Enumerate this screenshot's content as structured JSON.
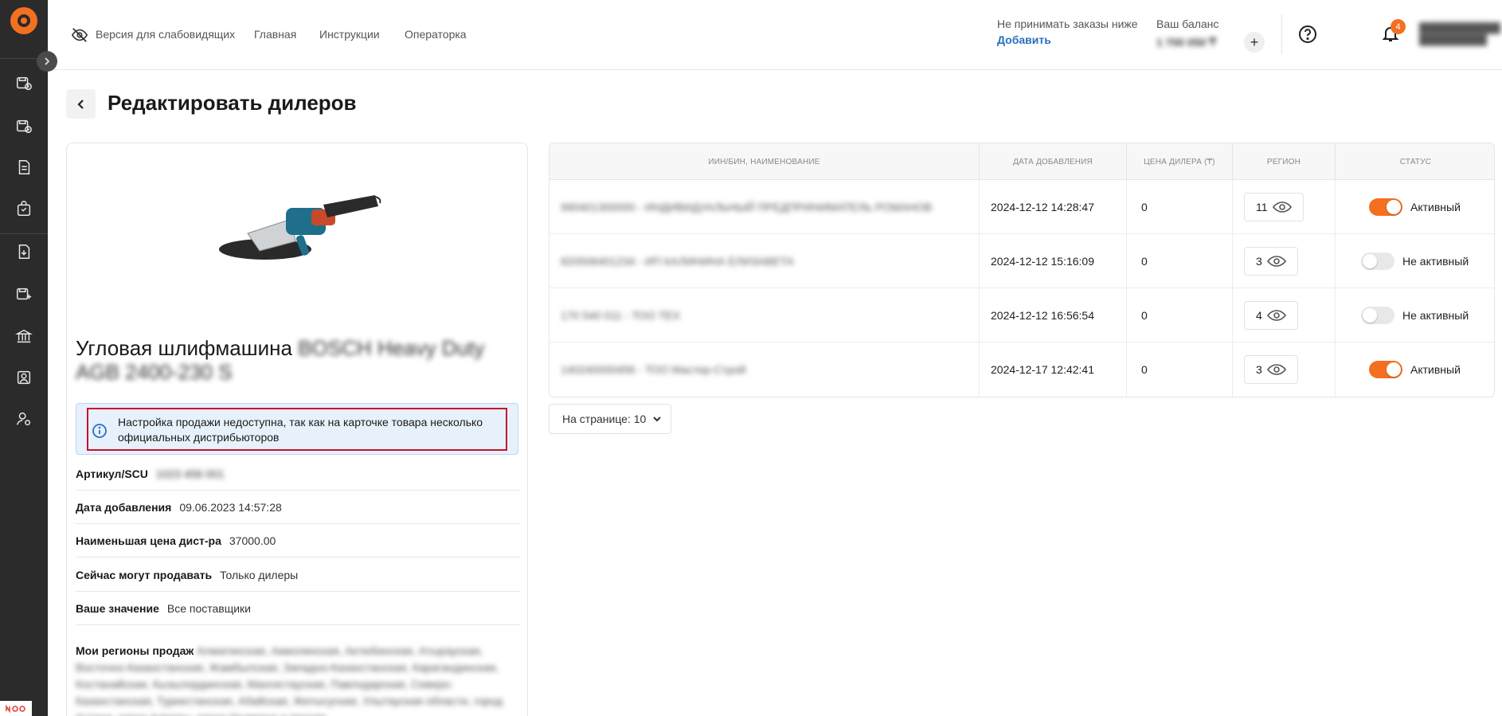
{
  "header": {
    "accessibility_label": "Версия для слабовидящих",
    "nav": [
      "Главная",
      "Инструкции",
      "Операторка"
    ],
    "no_orders_label": "Не принимать заказы ниже",
    "add_link": "Добавить",
    "balance_label": "Ваш баланс",
    "balance_value": "1 700 050 ₸",
    "notifications_count": "4",
    "user_name": "████████████ ██████████"
  },
  "page": {
    "title": "Редактировать дилеров"
  },
  "product": {
    "title": "Угловая шлифмашина",
    "title_blurred": "BOSCH Heavy Duty AGB 2400-230 S",
    "info_message": "Настройка продажи недоступна, так как на карточке товара несколько официальных дистрибьюторов",
    "rows": [
      {
        "label": "Артикул/SCU",
        "value": "1023 456 001"
      },
      {
        "label": "Дата добавления",
        "value": "09.06.2023 14:57:28"
      },
      {
        "label": "Наименьшая цена дист-ра",
        "value": "37000.00"
      },
      {
        "label": "Сейчас могут продавать",
        "value": "Только дилеры"
      },
      {
        "label": "Ваше значение",
        "value": "Все поставщики"
      }
    ],
    "regions_label": "Мои регионы продаж",
    "regions_value": "Алматинская, Акмолинская, Актюбинская, Атырауская, Восточно-Казахстанская, Жамбылская, Западно-Казахстанская, Карагандинская, Костанайская, Кызылординская, Мангистауская, Павлодарская, Северо-Казахстанская, Туркестанская, Абайская, Жетысуская, Улытауская области, город Астана, город Алматы, город Шымкент и прочие"
  },
  "table": {
    "headers": [
      "ИИН/БИН, наименование",
      "Дата добавления",
      "Цена дилера (₸)",
      "Регион",
      "Статус"
    ],
    "rows": [
      {
        "name": "990401300000 - ИНДИВИДУАЛЬНЫЙ ПРЕДПРИНИМАТЕЛЬ РОМАНОВ",
        "date": "2024-12-12 14:28:47",
        "price": "0",
        "region": "11",
        "status": "Активный",
        "active": true
      },
      {
        "name": "820506401234 - ИП КАЛИНИНА ЕЛИЗАВЕТА",
        "date": "2024-12-12 15:16:09",
        "price": "0",
        "region": "3",
        "status": "Не активный",
        "active": false
      },
      {
        "name": "170 540 011 - ТОО ТЕХ",
        "date": "2024-12-12 16:56:54",
        "price": "0",
        "region": "4",
        "status": "Не активный",
        "active": false
      },
      {
        "name": "140240000456 - ТОО Мастер-Строй",
        "date": "2024-12-17 12:42:41",
        "price": "0",
        "region": "3",
        "status": "Активный",
        "active": true
      }
    ],
    "per_page": "На странице: 10"
  }
}
